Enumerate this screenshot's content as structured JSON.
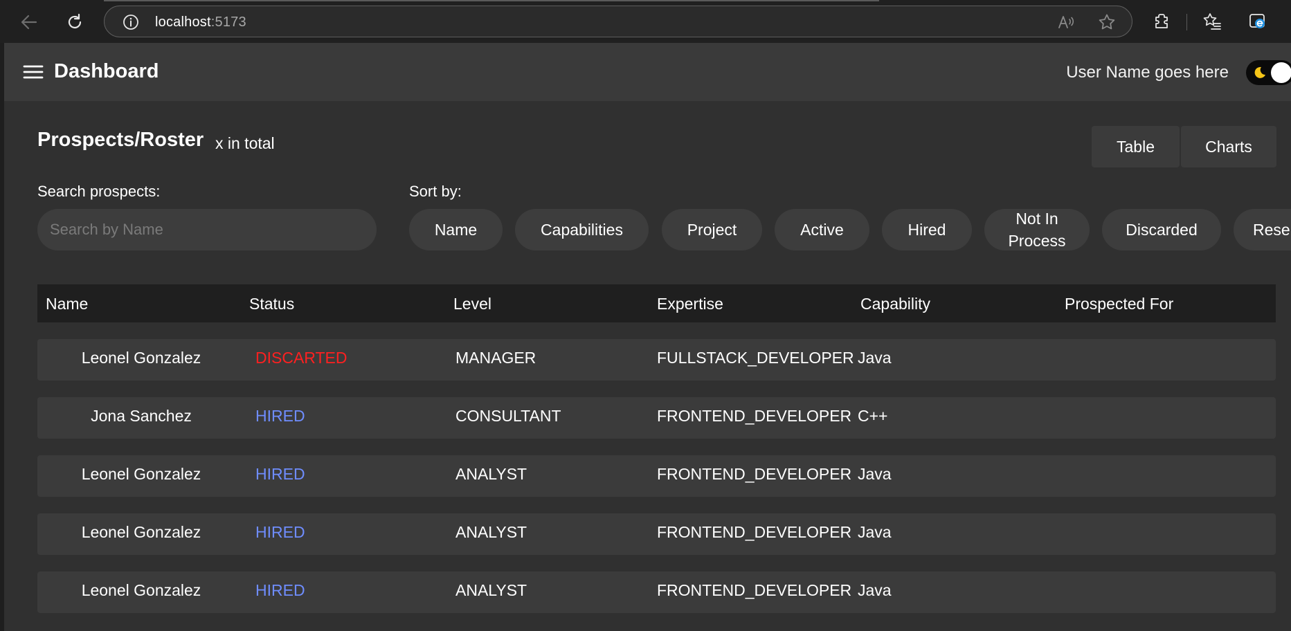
{
  "browser": {
    "url_host": "localhost",
    "url_port": ":5173"
  },
  "header": {
    "title": "Dashboard",
    "user_name": "User Name goes here"
  },
  "page": {
    "title": "Prospects/Roster",
    "count_text": "x in total",
    "view_toggle": {
      "table": "Table",
      "charts": "Charts"
    }
  },
  "search": {
    "label": "Search prospects:",
    "placeholder": "Search by Name"
  },
  "sort": {
    "label": "Sort by:",
    "chips": [
      "Name",
      "Capabilities",
      "Project",
      "Active",
      "Hired",
      "Not In\nProcess",
      "Discarded",
      "Rese"
    ]
  },
  "table": {
    "columns": [
      "Name",
      "Status",
      "Level",
      "Expertise",
      "Capability",
      "Prospected For"
    ],
    "rows": [
      {
        "name": "Leonel Gonzalez",
        "status": "DISCARTED",
        "level": "MANAGER",
        "expertise": "FULLSTACK_DEVELOPER",
        "capability": "Java",
        "prospected_for": ""
      },
      {
        "name": "Jona Sanchez",
        "status": "HIRED",
        "level": "CONSULTANT",
        "expertise": "FRONTEND_DEVELOPER",
        "capability": "C++",
        "prospected_for": ""
      },
      {
        "name": "Leonel Gonzalez",
        "status": "HIRED",
        "level": "ANALYST",
        "expertise": "FRONTEND_DEVELOPER",
        "capability": "Java",
        "prospected_for": ""
      },
      {
        "name": "Leonel Gonzalez",
        "status": "HIRED",
        "level": "ANALYST",
        "expertise": "FRONTEND_DEVELOPER",
        "capability": "Java",
        "prospected_for": ""
      },
      {
        "name": "Leonel Gonzalez",
        "status": "HIRED",
        "level": "ANALYST",
        "expertise": "FRONTEND_DEVELOPER",
        "capability": "Java",
        "prospected_for": ""
      }
    ]
  },
  "colors": {
    "status_discarded": "#ff2020",
    "status_hired": "#6f8dff",
    "toggle_moon": "#f5c518"
  }
}
